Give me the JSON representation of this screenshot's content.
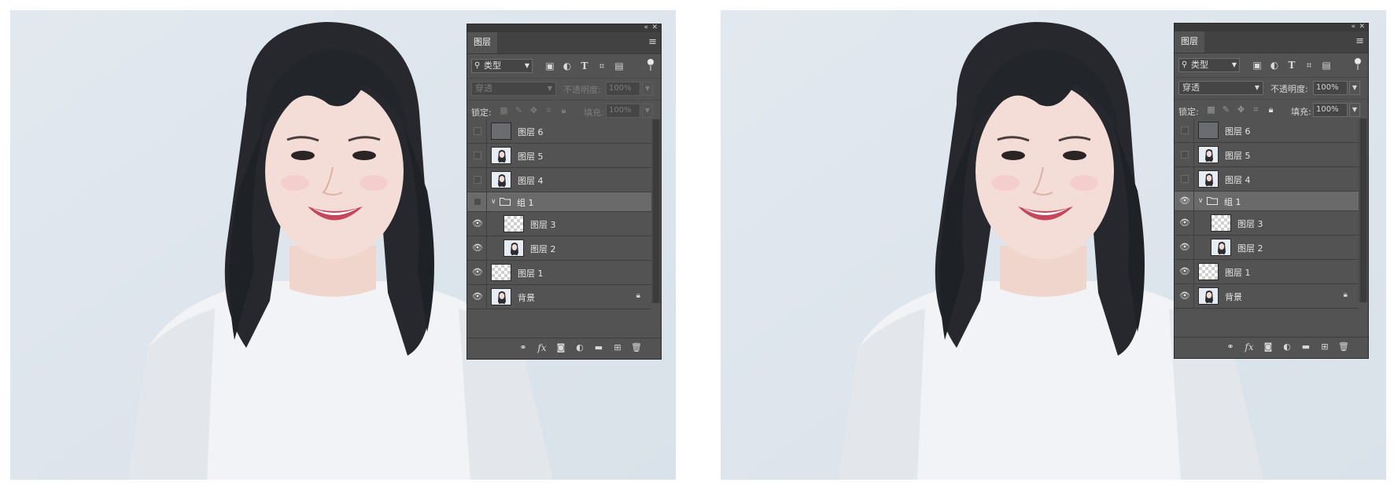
{
  "panels": [
    {
      "id": "left",
      "tab_title": "图层",
      "filter": {
        "kind_label": "类型"
      },
      "blend_mode": "穿透",
      "opacity_label": "不透明度:",
      "opacity_value": "100%",
      "lock_label": "锁定:",
      "fill_label": "填充:",
      "fill_value": "100%",
      "group_visible": false,
      "dimmed_controls": true
    },
    {
      "id": "right",
      "tab_title": "图层",
      "filter": {
        "kind_label": "类型"
      },
      "blend_mode": "穿透",
      "opacity_label": "不透明度:",
      "opacity_value": "100%",
      "lock_label": "锁定:",
      "fill_label": "填充:",
      "fill_value": "100%",
      "group_visible": true,
      "dimmed_controls": false
    }
  ],
  "layers": {
    "layer6": "图层 6",
    "layer5": "图层 5",
    "layer4": "图层 4",
    "group1": "组 1",
    "layer3": "图层 3",
    "layer2": "图层 2",
    "layer1": "图层 1",
    "background": "背景"
  },
  "icons": {
    "filter": [
      "image-filter-icon",
      "adjustment-filter-icon",
      "type-filter-icon",
      "shape-filter-icon",
      "smart-object-filter-icon"
    ],
    "lock": [
      "lock-transparent-pixels-icon",
      "lock-image-pixels-icon",
      "lock-position-icon",
      "lock-artboard-icon",
      "lock-all-icon"
    ],
    "bottom": [
      "link-layers-icon",
      "layer-style-icon",
      "add-mask-icon",
      "adjustment-layer-icon",
      "new-group-icon",
      "new-layer-icon",
      "delete-layer-icon"
    ]
  },
  "colors": {
    "panel_bg": "#535353",
    "panel_dark": "#424242",
    "selected_row": "#6a6a6a",
    "photo_bg": "#dde5ec"
  }
}
